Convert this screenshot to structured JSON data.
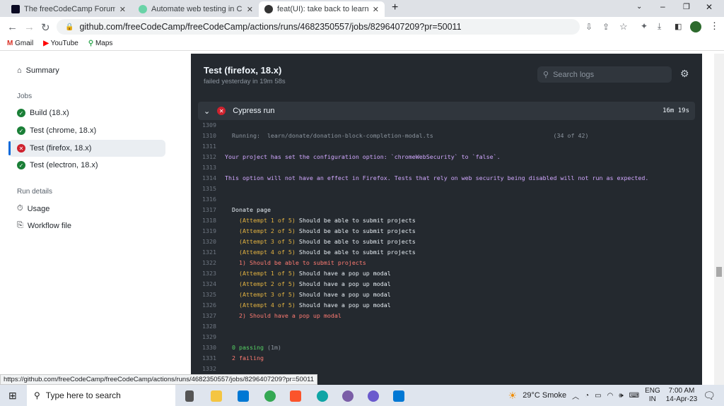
{
  "browser": {
    "tabs": [
      {
        "title": "The freeCodeCamp Forum - Join",
        "color": "#0a0a23"
      },
      {
        "title": "Automate web testing in CI with",
        "color": "#69d3a7"
      },
      {
        "title": "feat(UI): take back to learn map a",
        "color": "#cf222e"
      }
    ],
    "new_tab": "+",
    "url": "github.com/freeCodeCamp/freeCodeCamp/actions/runs/4682350557/jobs/8296407209?pr=50011",
    "bookmarks": [
      "Gmail",
      "YouTube",
      "Maps"
    ]
  },
  "sidebar": {
    "summary": "Summary",
    "jobs_heading": "Jobs",
    "jobs": [
      {
        "label": "Build (18.x)",
        "status": "success"
      },
      {
        "label": "Test (chrome, 18.x)",
        "status": "success"
      },
      {
        "label": "Test (firefox, 18.x)",
        "status": "failure"
      },
      {
        "label": "Test (electron, 18.x)",
        "status": "success"
      }
    ],
    "run_details_heading": "Run details",
    "usage": "Usage",
    "workflow_file": "Workflow file"
  },
  "job": {
    "title": "Test (firefox, 18.x)",
    "subtitle": "failed yesterday in 19m 58s",
    "search_placeholder": "Search logs",
    "step_name": "Cypress run",
    "step_duration": "16m 19s",
    "log": [
      {
        "n": "1309",
        "text": "",
        "c": "gray"
      },
      {
        "n": "1310",
        "text": "  Running:  learn/donate/donation-block-completion-modal.ts                                  (34 of 42)",
        "c": "gray"
      },
      {
        "n": "1311",
        "text": "",
        "c": "gray"
      },
      {
        "n": "1312",
        "text": "Your project has set the configuration option: `chromeWebSecurity` to `false`.",
        "c": "purple"
      },
      {
        "n": "1313",
        "text": "",
        "c": "gray"
      },
      {
        "n": "1314",
        "text": "This option will not have an effect in Firefox. Tests that rely on web security being disabled will not run as expected.",
        "c": "purple"
      },
      {
        "n": "1315",
        "text": "",
        "c": "gray"
      },
      {
        "n": "1316",
        "text": "",
        "c": "gray"
      },
      {
        "n": "1317",
        "text": "  Donate page",
        "c": "white"
      },
      {
        "n": "1318",
        "pre": "    (Attempt 1 of 5)",
        "text": " Should be able to submit projects",
        "c": "white"
      },
      {
        "n": "1319",
        "pre": "    (Attempt 2 of 5)",
        "text": " Should be able to submit projects",
        "c": "white"
      },
      {
        "n": "1320",
        "pre": "    (Attempt 3 of 5)",
        "text": " Should be able to submit projects",
        "c": "white"
      },
      {
        "n": "1321",
        "pre": "    (Attempt 4 of 5)",
        "text": " Should be able to submit projects",
        "c": "white"
      },
      {
        "n": "1322",
        "text": "    1) Should be able to submit projects",
        "c": "red"
      },
      {
        "n": "1323",
        "pre": "    (Attempt 1 of 5)",
        "text": " Should have a pop up modal",
        "c": "white"
      },
      {
        "n": "1324",
        "pre": "    (Attempt 2 of 5)",
        "text": " Should have a pop up modal",
        "c": "white"
      },
      {
        "n": "1325",
        "pre": "    (Attempt 3 of 5)",
        "text": " Should have a pop up modal",
        "c": "white"
      },
      {
        "n": "1326",
        "pre": "    (Attempt 4 of 5)",
        "text": " Should have a pop up modal",
        "c": "white"
      },
      {
        "n": "1327",
        "text": "    2) Should have a pop up modal",
        "c": "red"
      },
      {
        "n": "1328",
        "text": "",
        "c": "gray"
      },
      {
        "n": "1329",
        "text": "",
        "c": "gray"
      },
      {
        "n": "1330",
        "pre": "  0 passing",
        "text": " (1m)",
        "c": "gray",
        "prec": "green"
      },
      {
        "n": "1331",
        "text": "  2 failing",
        "c": "red"
      },
      {
        "n": "1332",
        "text": "",
        "c": "gray"
      }
    ]
  },
  "status_url": "https://github.com/freeCodeCamp/freeCodeCamp/actions/runs/4682350557/jobs/8296407209?pr=50011",
  "taskbar": {
    "search_placeholder": "Type here to search",
    "weather": "29°C  Smoke",
    "lang1": "ENG",
    "lang2": "IN",
    "time": "7:00 AM",
    "date": "14-Apr-23"
  }
}
